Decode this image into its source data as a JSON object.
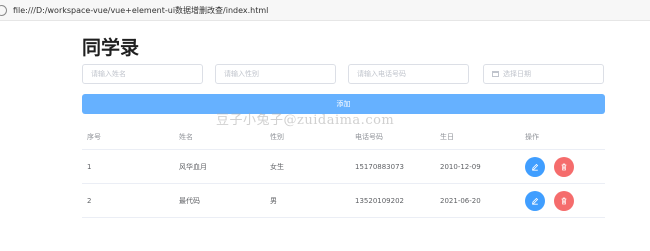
{
  "browser": {
    "url": "file:///D:/workspace-vue/vue+element-ui数据增删改查/index.html"
  },
  "page": {
    "title": "同学录"
  },
  "form": {
    "name_placeholder": "请输入姓名",
    "gender_placeholder": "请输入性别",
    "phone_placeholder": "请输入电话号码",
    "date_placeholder": "选择日期",
    "add_label": "添加"
  },
  "watermark": "豆子小兔子@zuidaima.com",
  "table": {
    "headers": [
      "序号",
      "姓名",
      "性别",
      "电话号码",
      "生日",
      "操作"
    ],
    "rows": [
      {
        "index": "1",
        "name": "风华血月",
        "gender": "女生",
        "phone": "15170883073",
        "birthday": "2010-12-09"
      },
      {
        "index": "2",
        "name": "最代码",
        "gender": "男",
        "phone": "13520109202",
        "birthday": "2021-06-20"
      }
    ]
  },
  "colors": {
    "primary": "#409eff",
    "primary_light": "#66b1ff",
    "danger": "#f56c6c"
  },
  "icons": {
    "edit": "edit-icon",
    "delete": "delete-icon",
    "date": "calendar-icon"
  }
}
